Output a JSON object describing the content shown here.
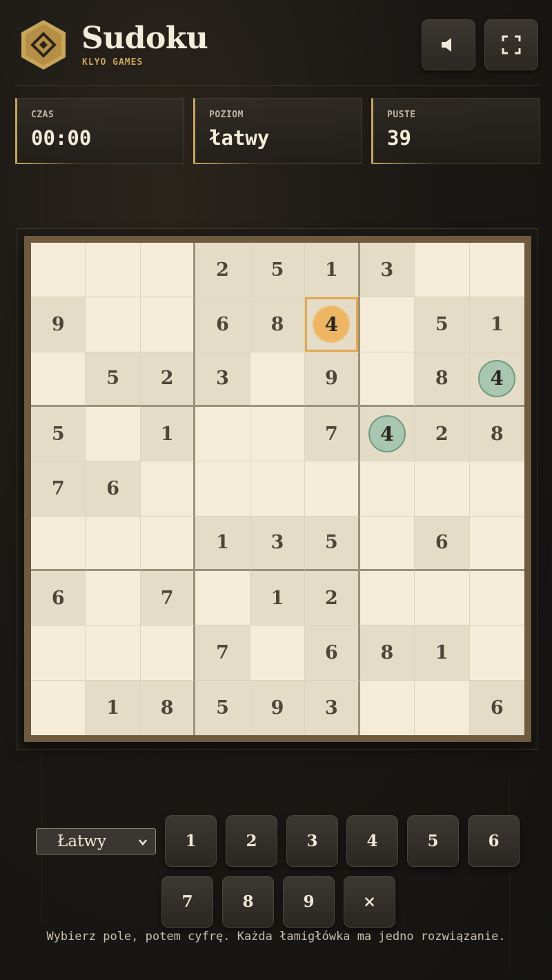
{
  "header": {
    "title": "Sudoku",
    "subtitle": "KLYO GAMES",
    "logo_icon": "diamond-logo-icon",
    "sound_icon": "speaker-icon",
    "fullscreen_icon": "fullscreen-icon"
  },
  "stats": [
    {
      "label": "CZAS",
      "value": "00:00"
    },
    {
      "label": "POZIOM",
      "value": "łatwy"
    },
    {
      "label": "PUSTE",
      "value": "39"
    }
  ],
  "board": {
    "rows": [
      [
        "",
        "",
        "",
        "2",
        "5",
        "1",
        "3",
        "",
        ""
      ],
      [
        "9",
        "",
        "",
        "6",
        "8",
        "4",
        "",
        "5",
        "1"
      ],
      [
        "",
        "5",
        "2",
        "3",
        "",
        "9",
        "",
        "8",
        "4"
      ],
      [
        "5",
        "",
        "1",
        "",
        "",
        "7",
        "4",
        "2",
        "8"
      ],
      [
        "7",
        "6",
        "",
        "",
        "",
        "",
        "",
        "",
        ""
      ],
      [
        "",
        "",
        "",
        "1",
        "3",
        "5",
        "",
        "6",
        ""
      ],
      [
        "6",
        "",
        "7",
        "",
        "1",
        "2",
        "",
        "",
        ""
      ],
      [
        "",
        "",
        "",
        "7",
        "",
        "6",
        "8",
        "1",
        ""
      ],
      [
        "",
        "1",
        "8",
        "5",
        "9",
        "3",
        "",
        "",
        "6"
      ]
    ],
    "selected": [
      1,
      5
    ],
    "highlighted": [
      [
        2,
        8
      ],
      [
        3,
        6
      ]
    ],
    "colors": {
      "selected": "#eeb664",
      "highlighted": "#a9c6b1",
      "given_bg": "#e4dcc7",
      "empty_bg": "#f4ecd9"
    }
  },
  "controls": {
    "difficulty_selected": "Łatwy",
    "numbers": [
      "1",
      "2",
      "3",
      "4",
      "5",
      "6",
      "7",
      "8",
      "9"
    ],
    "erase_label": "×"
  },
  "hint": "Wybierz pole, potem cyfrę. Każda łamigłówka ma jedno rozwiązanie."
}
